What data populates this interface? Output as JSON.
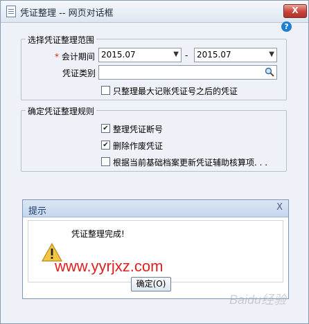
{
  "window": {
    "title": "凭证整理 -- 网页对话框",
    "close_label": "X",
    "help_label": "?"
  },
  "range_group": {
    "legend": "选择凭证整理范围",
    "period_label": "会计期间",
    "required_mark": "*",
    "period_from": "2015.07",
    "period_sep": "-",
    "period_to": "2015.07",
    "voucher_type_label": "凭证类别",
    "voucher_type_value": "",
    "only_after_max": {
      "label": "只整理最大记账凭证号之后的凭证",
      "checked": false
    }
  },
  "rules_group": {
    "legend": "确定凭证整理规则",
    "items": [
      {
        "label": "整理凭证断号",
        "checked": true
      },
      {
        "label": "删除作废凭证",
        "checked": true
      },
      {
        "label": "根据当前基础档案更新凭证辅助核算项. . .",
        "checked": false
      }
    ]
  },
  "alert": {
    "title": "提示",
    "close_label": "X",
    "message": "凭证整理完成!",
    "ok_label": "确定(O)"
  },
  "watermark": {
    "text": "www.yyrjxz.com",
    "color": "#e02020"
  },
  "baidu_watermark": "Baidu经验",
  "check_glyph": "✔"
}
